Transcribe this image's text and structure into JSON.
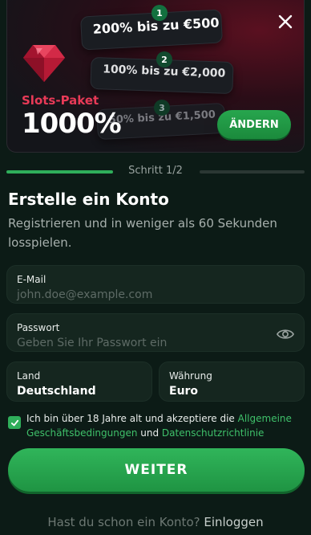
{
  "promo": {
    "label": "Slots-Paket",
    "percent": "1000%",
    "tiers": [
      {
        "num": "1",
        "text": "200% bis zu €500"
      },
      {
        "num": "2",
        "text": "100% bis zu €2,000"
      },
      {
        "num": "3",
        "text": "50% bis zu €1,500"
      }
    ],
    "change_label": "ÄNDERN"
  },
  "step": {
    "text": "Schritt 1/2"
  },
  "form": {
    "title": "Erstelle ein Konto",
    "subtitle": "Registrieren und in weniger als 60 Sekunden losspielen.",
    "email": {
      "label": "E-Mail",
      "placeholder": "john.doe@example.com"
    },
    "password": {
      "label": "Passwort",
      "placeholder": "Geben Sie Ihr Passwort ein"
    },
    "country": {
      "label": "Land",
      "value": "Deutschland"
    },
    "currency": {
      "label": "Währung",
      "value": "Euro"
    },
    "terms": {
      "prefix": "Ich bin über 18 Jahre alt und akzeptiere die ",
      "link1": "Allgemeine Geschäftsbedingungen",
      "middle": " und ",
      "link2": "Datenschutzrichtlinie",
      "checked": true
    },
    "continue_label": "WEITER"
  },
  "footer": {
    "question": "Hast du schon ein Konto?",
    "login_label": "Einloggen"
  },
  "colors": {
    "accent": "#2fae5a",
    "brand_red": "#e83a57",
    "background": "#0c1b16"
  },
  "icons": [
    "close-icon",
    "gem-icon",
    "eye-icon",
    "check-icon"
  ]
}
